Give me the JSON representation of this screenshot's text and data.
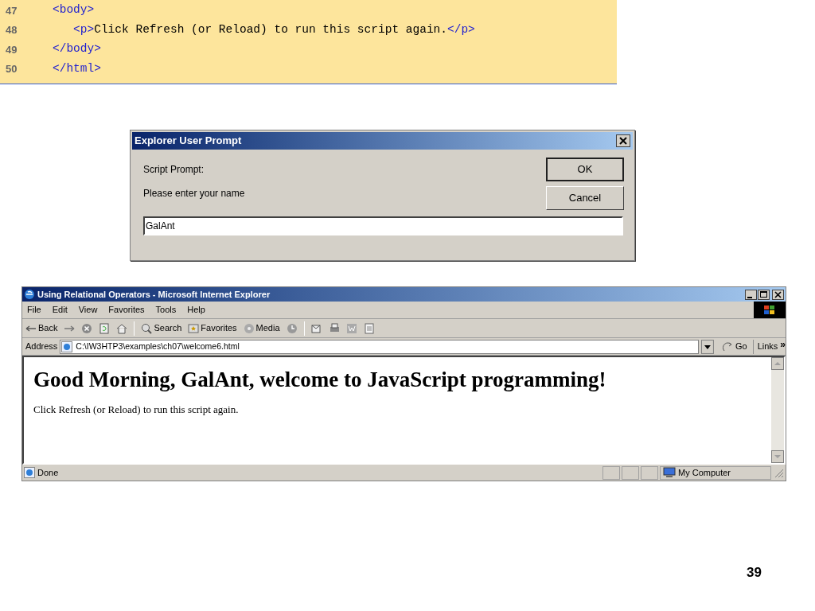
{
  "code_listing": {
    "lines": [
      {
        "number": "47",
        "segments": [
          {
            "kind": "tag",
            "text": "<body>"
          }
        ]
      },
      {
        "number": "48",
        "segments": [
          {
            "kind": "tag",
            "text": "   <p>"
          },
          {
            "kind": "text",
            "text": "Click Refresh (or Reload) to run this script again."
          },
          {
            "kind": "tag",
            "text": "</p>"
          }
        ]
      },
      {
        "number": "49",
        "segments": [
          {
            "kind": "tag",
            "text": "</body>"
          }
        ]
      },
      {
        "number": "50",
        "segments": [
          {
            "kind": "tag",
            "text": "</html>"
          }
        ]
      }
    ]
  },
  "prompt_dialog": {
    "title": "Explorer User Prompt",
    "label": "Script Prompt:",
    "message": "Please enter your name",
    "input_value": "GalAnt",
    "buttons": [
      {
        "label": "OK",
        "default": true
      },
      {
        "label": "Cancel",
        "default": false
      }
    ]
  },
  "browser": {
    "title": "Using Relational Operators - Microsoft Internet Explorer",
    "menu": [
      "File",
      "Edit",
      "View",
      "Favorites",
      "Tools",
      "Help"
    ],
    "toolbar": [
      {
        "kind": "back",
        "label": "Back"
      },
      {
        "kind": "forward"
      },
      {
        "kind": "stop"
      },
      {
        "kind": "refresh"
      },
      {
        "kind": "home"
      },
      {
        "kind": "sep"
      },
      {
        "kind": "search",
        "label": "Search"
      },
      {
        "kind": "favorites",
        "label": "Favorites"
      },
      {
        "kind": "media",
        "label": "Media"
      },
      {
        "kind": "history"
      },
      {
        "kind": "sep"
      },
      {
        "kind": "mail"
      },
      {
        "kind": "print"
      },
      {
        "kind": "word"
      },
      {
        "kind": "discuss"
      }
    ],
    "address_label": "Address",
    "address": "C:\\IW3HTP3\\examples\\ch07\\welcome6.html",
    "go": "Go",
    "links": "Links",
    "links_more": "»",
    "heading": "Good Morning, GalAnt, welcome to JavaScript programming!",
    "paragraph": "Click Refresh (or Reload) to run this script again.",
    "status": "Done",
    "zone": "My Computer"
  },
  "slide_number": "39"
}
